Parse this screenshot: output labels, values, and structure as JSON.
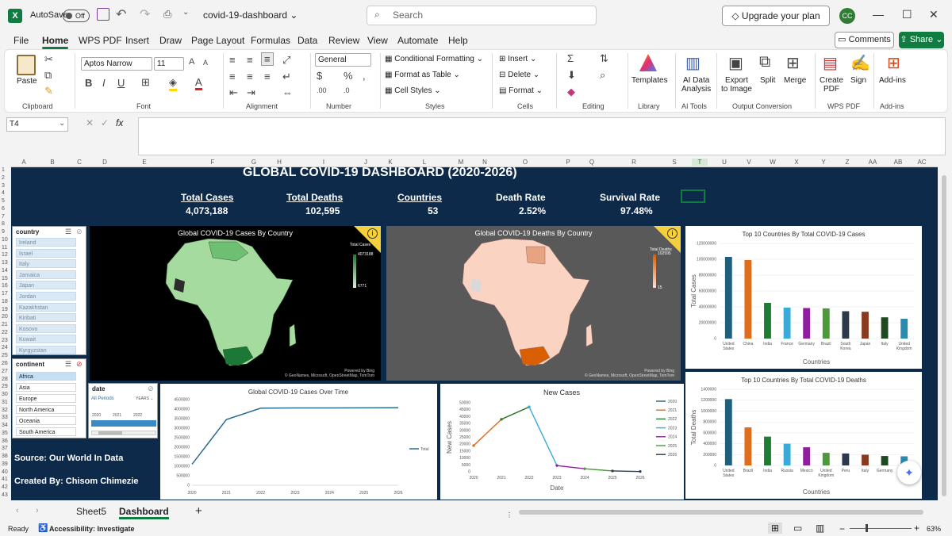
{
  "titlebar": {
    "autosave_label": "AutoSave",
    "autosave_state": "Off",
    "filename": "covid-19-dashboard",
    "search_placeholder": "Search",
    "upgrade_label": "Upgrade your plan",
    "user_initials": "CC"
  },
  "menu": [
    "File",
    "Home",
    "WPS PDF",
    "Insert",
    "Draw",
    "Page Layout",
    "Formulas",
    "Data",
    "Review",
    "View",
    "Automate",
    "Help"
  ],
  "menu_active": "Home",
  "actions": {
    "comments": "Comments",
    "share": "Share"
  },
  "ribbon": {
    "paste": "Paste",
    "font_name": "Aptos Narrow",
    "font_size": "11",
    "number_format": "General",
    "conditional_formatting": "Conditional Formatting",
    "format_as_table": "Format as Table",
    "cell_styles": "Cell Styles",
    "insert": "Insert",
    "delete": "Delete",
    "format": "Format",
    "templates": "Templates",
    "ai_data_analysis_1": "AI Data",
    "ai_data_analysis_2": "Analysis",
    "export_1": "Export",
    "export_2": "to Image",
    "split": "Split",
    "merge": "Merge",
    "create_pdf_1": "Create",
    "create_pdf_2": "PDF",
    "sign": "Sign",
    "addins": "Add-ins",
    "groups": {
      "clipboard": "Clipboard",
      "font": "Font",
      "alignment": "Alignment",
      "number": "Number",
      "styles": "Styles",
      "cells": "Cells",
      "editing": "Editing",
      "library": "Library",
      "ai_tools": "AI Tools",
      "output_conversion": "Output Conversion",
      "wps_pdf": "WPS PDF",
      "addins": "Add-ins"
    }
  },
  "formula_bar": {
    "name_box": "T4",
    "fx": "fx"
  },
  "columns": [
    "A",
    "B",
    "C",
    "D",
    "E",
    "F",
    "G",
    "H",
    "I",
    "J",
    "K",
    "L",
    "M",
    "N",
    "O",
    "P",
    "Q",
    "R",
    "S",
    "T",
    "U",
    "V",
    "W",
    "X",
    "Y",
    "Z",
    "AA",
    "AB",
    "AC"
  ],
  "rows": [
    "1",
    "2",
    "3",
    "4",
    "5",
    "6",
    "7",
    "8",
    "9",
    "10",
    "11",
    "12",
    "13",
    "14",
    "15",
    "16",
    "17",
    "18",
    "19",
    "20",
    "21",
    "22",
    "23",
    "24",
    "25",
    "26",
    "27",
    "28",
    "29",
    "30",
    "31",
    "32",
    "33",
    "34",
    "35",
    "36",
    "37",
    "38",
    "39",
    "40",
    "41",
    "42",
    "43"
  ],
  "dashboard": {
    "title": "GLOBAL COVID-19 DASHBOARD (2020-2026)",
    "kpis": [
      {
        "label": "Total Cases",
        "value": "4,073,188"
      },
      {
        "label": "Total Deaths",
        "value": "102,595"
      },
      {
        "label": "Countries",
        "value": "53"
      },
      {
        "label": "Death Rate",
        "value": "2.52%"
      },
      {
        "label": "Survival Rate",
        "value": "97.48%"
      }
    ],
    "source": "Source: Our World In Data",
    "created_by": "Created By: Chisom Chimezie"
  },
  "slicers": {
    "country": {
      "title": "country",
      "items": [
        "Ireland",
        "Israel",
        "Italy",
        "Jamaica",
        "Japan",
        "Jordan",
        "Kazakhstan",
        "Kiribati",
        "Kosovo",
        "Kuwait",
        "Kyrgyzstan"
      ]
    },
    "continent": {
      "title": "continent",
      "items": [
        "Africa",
        "Asia",
        "Europe",
        "North America",
        "Oceania",
        "South America"
      ],
      "selected": "Africa"
    },
    "date": {
      "title": "date",
      "periods": "All Periods",
      "unit": "YEARS",
      "years": [
        "2020",
        "2021",
        "2022"
      ]
    }
  },
  "maps": {
    "cases": {
      "title": "Global COVID-19 Cases By Country",
      "legend_title": "Total Cases",
      "legend_max": "4073188",
      "legend_min": "6771",
      "credit_1": "Powered by Bing",
      "credit_2": "© GeoNames, Microsoft, OpenStreetMap, TomTom",
      "low_color": "#d9f0d3",
      "high_color": "#1b7837"
    },
    "deaths": {
      "title": "Global COVID-19 Deaths By Country",
      "legend_title": "Total Deaths",
      "legend_max": "102595",
      "legend_min": "15",
      "credit_1": "Powered by Bing",
      "credit_2": "© GeoNames, Microsoft, OpenStreetMap, TomTom",
      "low_color": "#fde0d2",
      "high_color": "#d95f02"
    }
  },
  "chart_data": [
    {
      "type": "bar",
      "title": "Top 10 Countries By Total COVID-19 Cases",
      "xlabel": "Countries",
      "ylabel": "Total Cases",
      "categories": [
        "United States",
        "China",
        "India",
        "France",
        "Germany",
        "Brazil",
        "South Korea",
        "Japan",
        "Italy",
        "United Kingdom"
      ],
      "values": [
        103000000,
        99000000,
        45000000,
        39000000,
        38500000,
        38000000,
        34500000,
        33800000,
        26800000,
        25000000
      ],
      "colors": [
        "#1f5f7a",
        "#e06c1e",
        "#1e7d32",
        "#3aaad8",
        "#8e1e9e",
        "#4a9a3a",
        "#2b3a4a",
        "#8a3a1e",
        "#1f4a1f",
        "#2b8ab0"
      ],
      "yticks": [
        "0",
        "20000000",
        "40000000",
        "60000000",
        "80000000",
        "100000000",
        "120000000"
      ],
      "ylim": [
        0,
        120000000
      ]
    },
    {
      "type": "bar",
      "title": "Top 10 Countries By Total COVID-19 Deaths",
      "xlabel": "Countries",
      "ylabel": "Total Deaths",
      "categories": [
        "United States",
        "Brazil",
        "India",
        "Russia",
        "Mexico",
        "United Kingdom",
        "Peru",
        "Italy",
        "Germany",
        "France"
      ],
      "values": [
        1220000,
        700000,
        530000,
        400000,
        334000,
        232000,
        220000,
        197000,
        174000,
        168000
      ],
      "colors": [
        "#1f5f7a",
        "#e06c1e",
        "#1e7d32",
        "#3aaad8",
        "#8e1e9e",
        "#4a9a3a",
        "#2b3a4a",
        "#8a3a1e",
        "#1f4a1f",
        "#2b8ab0"
      ],
      "yticks": [
        "0",
        "200000",
        "400000",
        "600000",
        "800000",
        "1000000",
        "1200000",
        "1400000"
      ],
      "ylim": [
        0,
        1400000
      ]
    },
    {
      "type": "line",
      "title": "Global COVID-19 Cases Over Time",
      "x": [
        "2020",
        "2021",
        "2022",
        "2023",
        "2024",
        "2025",
        "2026"
      ],
      "series": [
        {
          "name": "Total",
          "values": [
            1100000,
            3450000,
            4050000,
            4060000,
            4065000,
            4070000,
            4073188
          ]
        }
      ],
      "yticks": [
        "0",
        "500000",
        "1000000",
        "1500000",
        "2000000",
        "2500000",
        "3000000",
        "3500000",
        "4000000",
        "4500000"
      ],
      "ylim": [
        0,
        4500000
      ]
    },
    {
      "type": "line",
      "title": "New Cases",
      "xlabel": "Date",
      "ylabel": "New Cases",
      "x": [
        "2020",
        "2021",
        "2022",
        "2023",
        "2024",
        "2025",
        "2026"
      ],
      "series": [
        {
          "name": "2020",
          "color": "#1f5f7a",
          "points": [
            [
              0,
              19000
            ]
          ]
        },
        {
          "name": "2021",
          "color": "#e06c1e",
          "points": [
            [
              0,
              19000
            ],
            [
              1,
              38000
            ],
            [
              2,
              47000
            ]
          ]
        },
        {
          "name": "2022",
          "color": "#1e7d32",
          "points": [
            [
              1,
              38000
            ],
            [
              2,
              47000
            ]
          ]
        },
        {
          "name": "2023",
          "color": "#3aaad8",
          "points": [
            [
              2,
              47000
            ],
            [
              3,
              4500
            ]
          ]
        },
        {
          "name": "2024",
          "color": "#8e1e9e",
          "points": [
            [
              3,
              4500
            ],
            [
              4,
              2200
            ]
          ]
        },
        {
          "name": "2025",
          "color": "#4a9a3a",
          "points": [
            [
              4,
              2200
            ],
            [
              5,
              600
            ]
          ]
        },
        {
          "name": "2026",
          "color": "#2b3a4a",
          "points": [
            [
              5,
              600
            ],
            [
              6,
              200
            ]
          ]
        }
      ],
      "yticks": [
        "0",
        "5000",
        "10000",
        "15000",
        "20000",
        "25000",
        "30000",
        "35000",
        "40000",
        "45000",
        "50000"
      ],
      "ylim": [
        0,
        50000
      ]
    }
  ],
  "tabs": {
    "items": [
      "Sheet5",
      "Dashboard"
    ],
    "active": "Dashboard"
  },
  "status": {
    "ready": "Ready",
    "accessibility": "Accessibility: Investigate",
    "zoom": "63%"
  }
}
